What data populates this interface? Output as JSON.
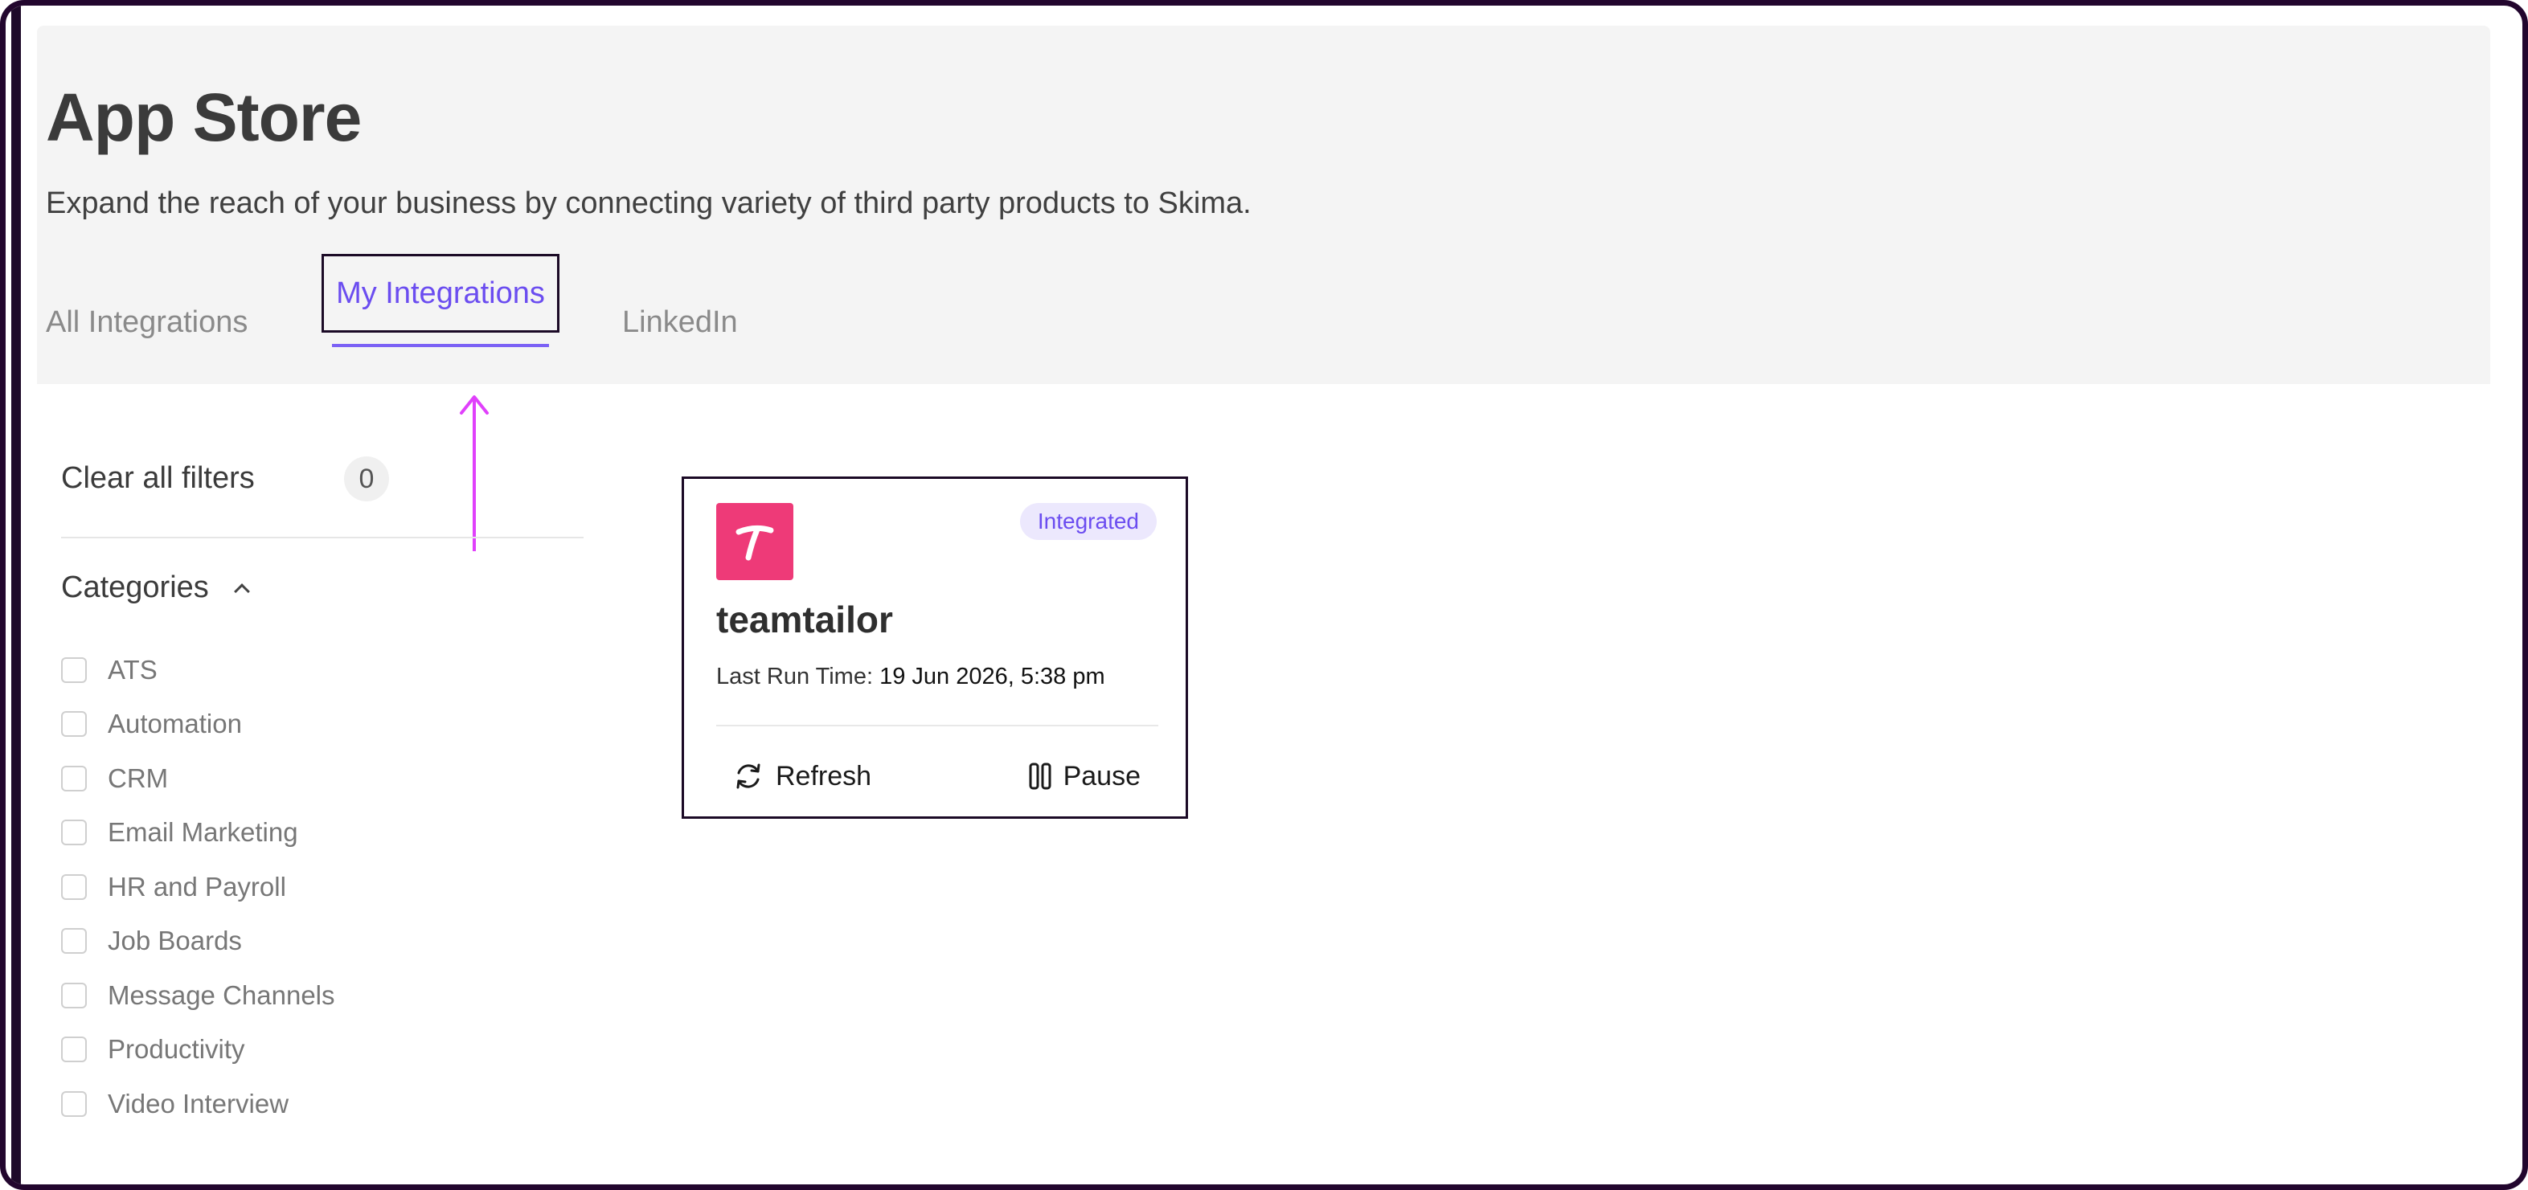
{
  "header": {
    "title": "App Store",
    "subtitle": "Expand the reach of your business by connecting variety of third party products to Skima."
  },
  "tabs": [
    {
      "label": "All Integrations",
      "active": false
    },
    {
      "label": "My Integrations",
      "active": true
    },
    {
      "label": "LinkedIn",
      "active": false
    }
  ],
  "sidebar": {
    "clear_filters_label": "Clear all filters",
    "filter_count": "0",
    "categories_label": "Categories",
    "categories": [
      "ATS",
      "Automation",
      "CRM",
      "Email Marketing",
      "HR and Payroll",
      "Job Boards",
      "Message Channels",
      "Productivity",
      "Video Interview"
    ]
  },
  "integration_card": {
    "name": "teamtailor",
    "logo_letter": "T",
    "badge": "Integrated",
    "last_run_label": "Last Run Time:",
    "last_run_value": "19 Jun 2026, 5:38 pm",
    "refresh_label": "Refresh",
    "pause_label": "Pause"
  },
  "colors": {
    "accent": "#6b4df0",
    "logo_bg": "#ee3a78",
    "annotation_arrow": "#e040fb",
    "frame": "#22062e"
  }
}
